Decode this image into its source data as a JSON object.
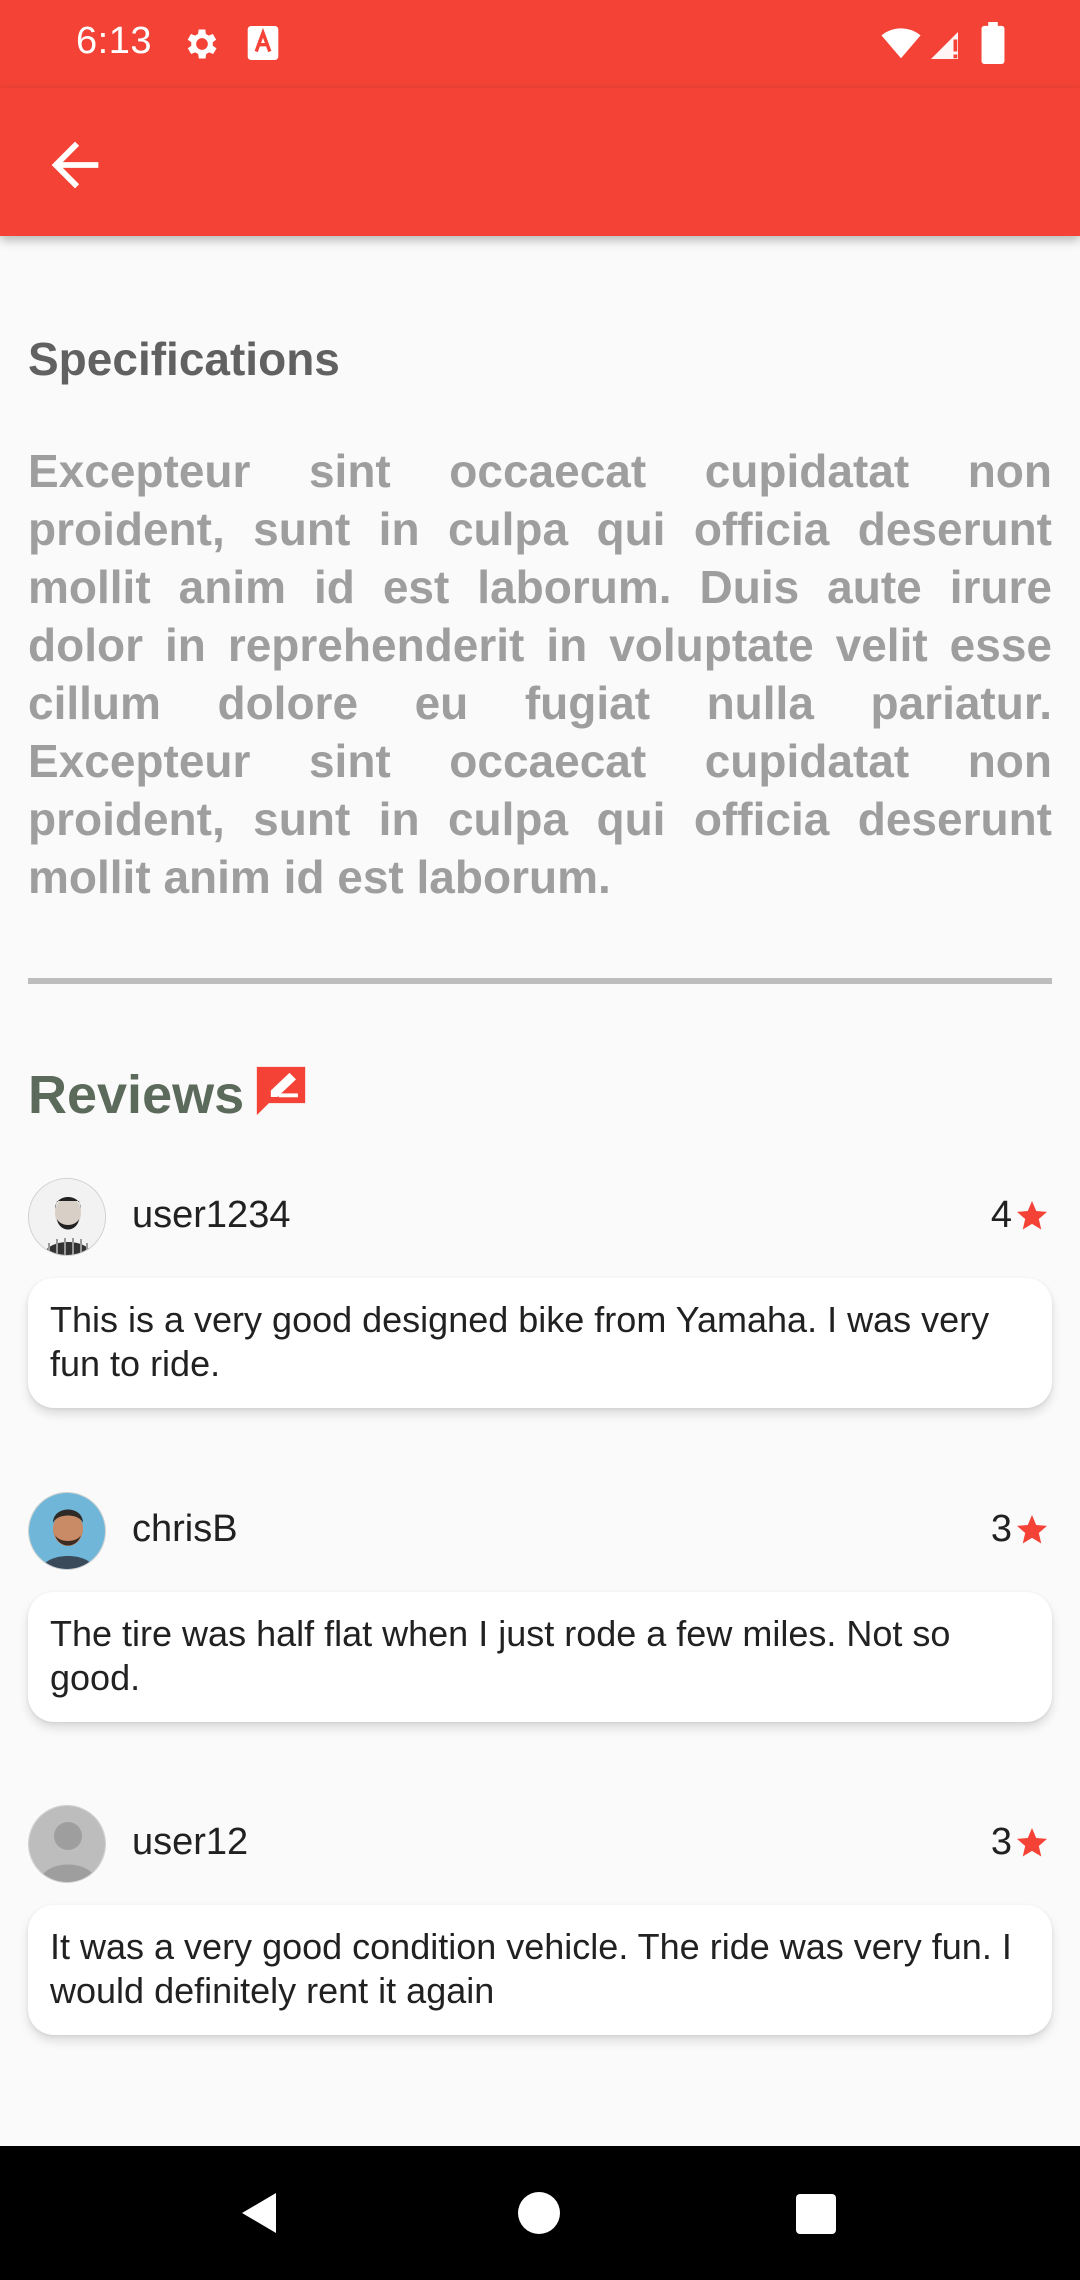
{
  "status_bar": {
    "time": "6:13",
    "icons": [
      "gear-icon",
      "a-text-icon",
      "wifi-icon",
      "signal-icon",
      "battery-icon"
    ]
  },
  "app_bar": {
    "back_icon": "arrow-back-icon",
    "color": "#f44336"
  },
  "specifications": {
    "title": "Specifications",
    "text": "Excepteur sint occaecat cupidatat non proident, sunt in culpa qui officia deserunt mollit anim id est laborum.  Duis aute irure dolor in reprehenderit in voluptate velit esse cillum dolore eu fugiat nulla pariatur. Excepteur sint occaecat cupidatat non proident, sunt in culpa qui officia deserunt mollit anim id est laborum."
  },
  "reviews": {
    "title": "Reviews",
    "icon": "write-review-icon",
    "items": [
      {
        "user": "user1234",
        "rating": "4",
        "text": "This is a very good designed bike from Yamaha. I was very fun to ride."
      },
      {
        "user": "chrisB",
        "rating": "3",
        "text": "The tire was half flat when I just rode a few miles. Not so good."
      },
      {
        "user": "user12",
        "rating": "3",
        "text": "It was a very good condition vehicle. The ride was very fun. I would definitely rent it again"
      }
    ]
  },
  "colors": {
    "accent": "#f44336",
    "star": "#f44336"
  }
}
